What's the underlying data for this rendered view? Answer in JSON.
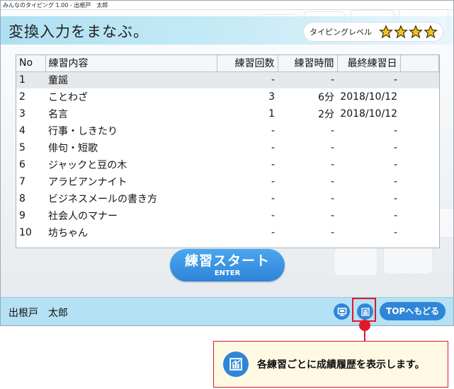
{
  "window": {
    "title": "みんなのタイピング 1.00 - 出根戸　太郎"
  },
  "header": {
    "title": "変換入力をまなぶ。",
    "level_label": "タイピングレベル",
    "stars": 4,
    "star_color": "#f3c21a"
  },
  "table": {
    "columns": [
      "No",
      "練習内容",
      "練習回数",
      "練習時間",
      "最終練習日"
    ],
    "rows": [
      {
        "no": "1",
        "name": "童謡",
        "count": "-",
        "time": "-",
        "date": "-"
      },
      {
        "no": "2",
        "name": "ことわざ",
        "count": "3",
        "time": "6分",
        "date": "2018/10/12"
      },
      {
        "no": "3",
        "name": "名言",
        "count": "1",
        "time": "2分",
        "date": "2018/10/12"
      },
      {
        "no": "4",
        "name": "行事・しきたり",
        "count": "-",
        "time": "-",
        "date": "-"
      },
      {
        "no": "5",
        "name": "俳句・短歌",
        "count": "-",
        "time": "-",
        "date": "-"
      },
      {
        "no": "6",
        "name": "ジャックと豆の木",
        "count": "-",
        "time": "-",
        "date": "-"
      },
      {
        "no": "7",
        "name": "アラビアンナイト",
        "count": "-",
        "time": "-",
        "date": "-"
      },
      {
        "no": "8",
        "name": "ビジネスメールの書き方",
        "count": "-",
        "time": "-",
        "date": "-"
      },
      {
        "no": "9",
        "name": "社会人のマナー",
        "count": "-",
        "time": "-",
        "date": "-"
      },
      {
        "no": "10",
        "name": "坊ちゃん",
        "count": "-",
        "time": "-",
        "date": "-"
      }
    ]
  },
  "start_button": {
    "label": "練習スタート",
    "sub_label": "ENTER"
  },
  "footer": {
    "user_name": "出根戸　太郎",
    "icons": [
      "monitor-icon",
      "history-chart-icon"
    ],
    "top_button": "TOPへもどる"
  },
  "callout": {
    "text": "各練習ごとに成績履歴を表示します。",
    "icon": "history-chart-icon"
  },
  "colors": {
    "accent_blue": "#2f86d6",
    "header_band": "#aee0f2",
    "footer_band": "#b4e1f3",
    "highlight_red": "#e0182a",
    "callout_bg": "#fff9e4"
  }
}
